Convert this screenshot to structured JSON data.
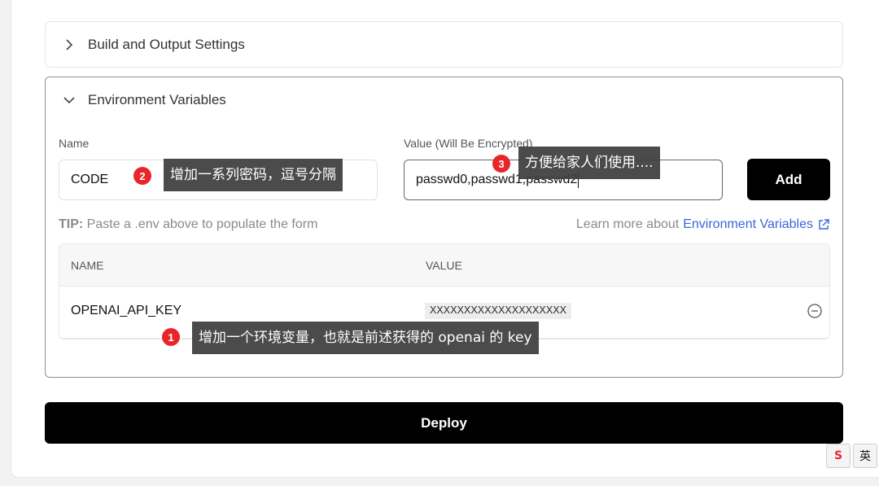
{
  "build_section": {
    "title": "Build and Output Settings"
  },
  "env_section": {
    "title": "Environment Variables",
    "name_label": "Name",
    "value_label": "Value (Will Be Encrypted)",
    "name_value": "CODE",
    "value_value": "passwd0,passwd1,passwd2",
    "add_label": "Add",
    "tip_prefix": "TIP:",
    "tip_text": "Paste a .env above to populate the form",
    "learn_text": "Learn more about",
    "learn_link": "Environment Variables",
    "table": {
      "headers": [
        "NAME",
        "VALUE"
      ],
      "rows": [
        {
          "name": "OPENAI_API_KEY",
          "value": "XXXXXXXXXXXXXXXXXXXX"
        }
      ]
    }
  },
  "deploy_label": "Deploy",
  "annotations": [
    {
      "num": "1",
      "text": "增加一个环境变量，也就是前述获得的 openai 的 key"
    },
    {
      "num": "2",
      "text": "增加一系列密码，逗号分隔"
    },
    {
      "num": "3",
      "text": "方便给家人们使用...."
    }
  ],
  "ime": {
    "sogou": "S",
    "lang": "英"
  },
  "colors": {
    "accent": "#3b67d6",
    "badge": "#e8262a",
    "button": "#000000"
  },
  "icons": [
    "chevron-right-icon",
    "chevron-down-icon",
    "external-link-icon",
    "remove-circle-icon"
  ]
}
